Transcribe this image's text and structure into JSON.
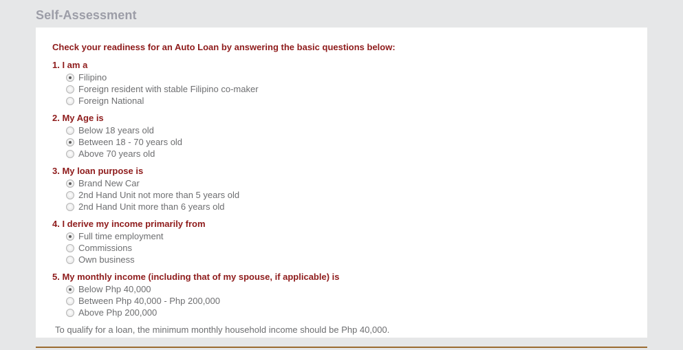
{
  "page": {
    "title": "Self-Assessment",
    "title_color": "#9c9da7",
    "background_color": "#e6e7e8",
    "card_background_color": "#ffffff",
    "accent_color": "#8e1b1b",
    "label_color": "#6d6e70",
    "rule_color": "#9a6b30"
  },
  "form": {
    "intro": "Check your readiness for an Auto Loan by answering the basic questions below:",
    "note": "To qualify for a loan, the minimum monthly household income should be Php 40,000.",
    "questions": [
      {
        "title": "1. I am a",
        "options": [
          {
            "label": "Filipino",
            "checked": true
          },
          {
            "label": "Foreign resident with stable Filipino co-maker",
            "checked": false
          },
          {
            "label": "Foreign National",
            "checked": false
          }
        ]
      },
      {
        "title": "2. My Age is",
        "options": [
          {
            "label": "Below 18 years old",
            "checked": false
          },
          {
            "label": "Between 18 - 70 years old",
            "checked": true
          },
          {
            "label": "Above 70 years old",
            "checked": false
          }
        ]
      },
      {
        "title": "3. My loan purpose is",
        "options": [
          {
            "label": "Brand New Car",
            "checked": true
          },
          {
            "label": "2nd Hand Unit not more than 5 years old",
            "checked": false
          },
          {
            "label": "2nd Hand Unit more than 6 years old",
            "checked": false
          }
        ]
      },
      {
        "title": "4. I derive my income primarily from",
        "options": [
          {
            "label": "Full time employment",
            "checked": true
          },
          {
            "label": "Commissions",
            "checked": false
          },
          {
            "label": "Own business",
            "checked": false
          }
        ]
      },
      {
        "title": "5. My monthly income (including that of my spouse, if applicable) is",
        "options": [
          {
            "label": "Below Php 40,000",
            "checked": true
          },
          {
            "label": "Between Php 40,000 - Php 200,000",
            "checked": false
          },
          {
            "label": "Above Php 200,000",
            "checked": false
          }
        ]
      }
    ]
  }
}
